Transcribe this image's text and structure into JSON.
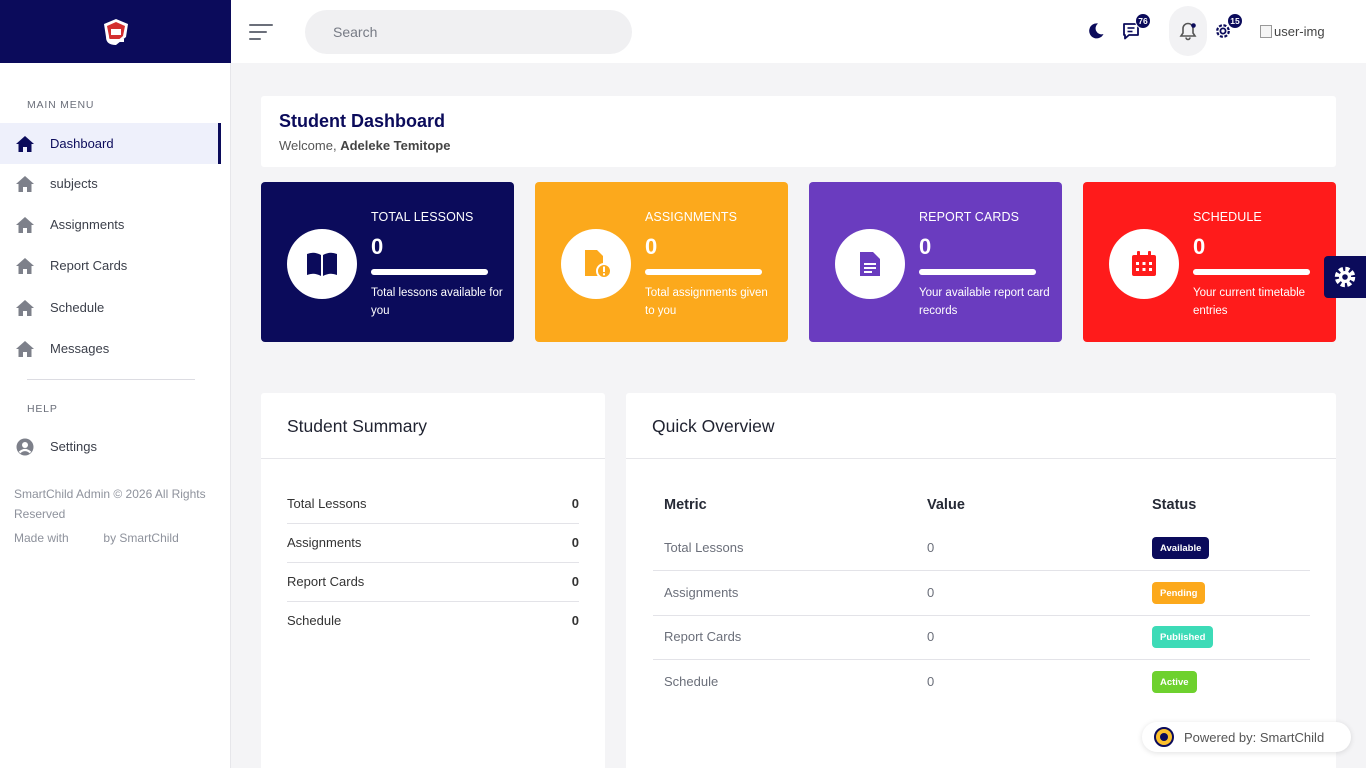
{
  "brand": {
    "logo_icon": "school-crest-icon"
  },
  "sidebar": {
    "main_menu_title": "MAIN MENU",
    "items": [
      {
        "label": "Dashboard",
        "icon": "home-icon",
        "active": true
      },
      {
        "label": "subjects",
        "icon": "home-icon"
      },
      {
        "label": "Assignments",
        "icon": "home-icon"
      },
      {
        "label": "Report Cards",
        "icon": "home-icon"
      },
      {
        "label": "Schedule",
        "icon": "home-icon"
      },
      {
        "label": "Messages",
        "icon": "home-icon"
      }
    ],
    "help_title": "HELP",
    "settings_label": "Settings",
    "copyright": "SmartChild Admin © 2026 All Rights Reserved",
    "made_with": "Made with",
    "made_by": "by SmartChild"
  },
  "topbar": {
    "search_placeholder": "Search",
    "messages_count": "76",
    "settings_count": "15",
    "user_img_alt": "user-img"
  },
  "page": {
    "title": "Student Dashboard",
    "welcome_prefix": "Welcome,",
    "user_name": "Adeleke Temitope"
  },
  "stats": [
    {
      "title": "TOTAL LESSONS",
      "value": "0",
      "desc": "Total lessons available for you",
      "color": "#0b0b5b",
      "icon": "book-icon",
      "progress": 1.0
    },
    {
      "title": "ASSIGNMENTS",
      "value": "0",
      "desc": "Total assignments given to you",
      "color": "#fca91c",
      "icon": "file-alert-icon",
      "progress": 1.0
    },
    {
      "title": "REPORT CARDS",
      "value": "0",
      "desc": "Your available report card records",
      "color": "#6a3cbf",
      "icon": "document-icon",
      "progress": 1.0
    },
    {
      "title": "SCHEDULE",
      "value": "0",
      "desc": "Your current timetable entries",
      "color": "#ff1b1b",
      "icon": "calendar-icon",
      "progress": 1.0
    }
  ],
  "summary": {
    "title": "Student Summary",
    "rows": [
      {
        "label": "Total Lessons",
        "value": "0"
      },
      {
        "label": "Assignments",
        "value": "0"
      },
      {
        "label": "Report Cards",
        "value": "0"
      },
      {
        "label": "Schedule",
        "value": "0"
      }
    ]
  },
  "overview": {
    "title": "Quick Overview",
    "headers": [
      "Metric",
      "Value",
      "Status"
    ],
    "rows": [
      {
        "metric": "Total Lessons",
        "value": "0",
        "status": "Available",
        "status_color": "#0b0b5b"
      },
      {
        "metric": "Assignments",
        "value": "0",
        "status": "Pending",
        "status_color": "#fca91c"
      },
      {
        "metric": "Report Cards",
        "value": "0",
        "status": "Published",
        "status_color": "#3ddbb7"
      },
      {
        "metric": "Schedule",
        "value": "0",
        "status": "Active",
        "status_color": "#6ed12e"
      }
    ]
  },
  "powered": {
    "label": "Powered by: SmartChild"
  }
}
